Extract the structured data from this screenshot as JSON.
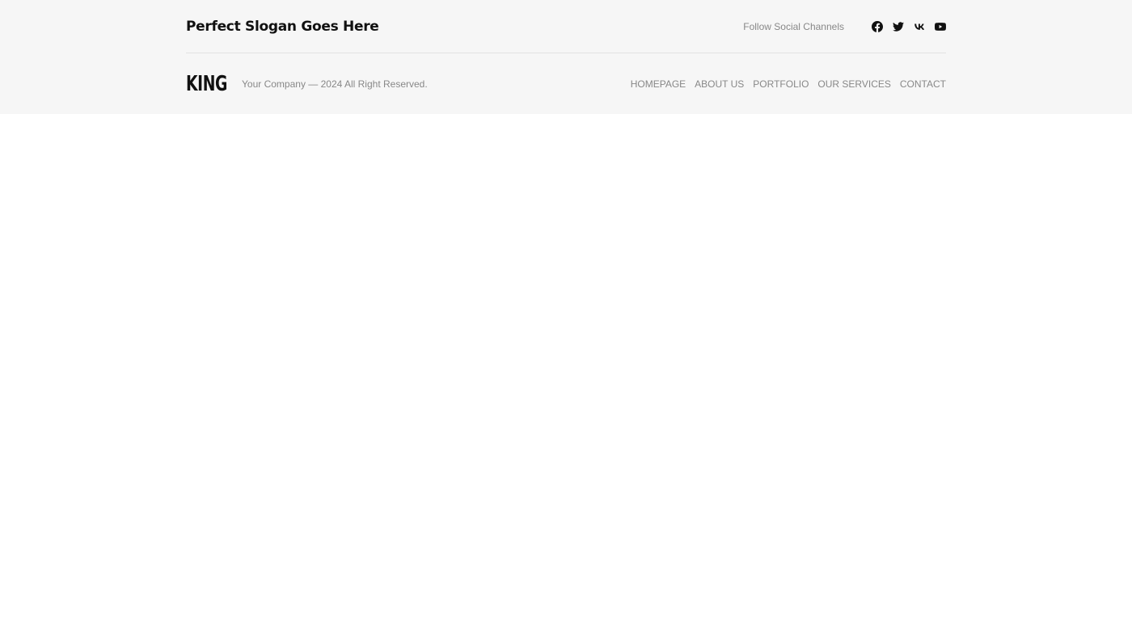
{
  "header": {
    "slogan": "Perfect Slogan Goes Here",
    "social_label": "Follow Social Channels",
    "social_icons": [
      "facebook-icon",
      "twitter-icon",
      "vk-icon",
      "youtube-icon"
    ]
  },
  "brand": {
    "logo": "KING",
    "copyright": "Your Company — 2024 All Right Reserved."
  },
  "nav": {
    "items": [
      "HOMEPAGE",
      "ABOUT US",
      "PORTFOLIO",
      "OUR SERVICES",
      "CONTACT"
    ]
  },
  "colors": {
    "footer_background": "#f6f6f6",
    "page_background": "#ffffff",
    "text_primary": "#111111",
    "text_muted": "#888888",
    "divider": "#e2e2e2"
  }
}
